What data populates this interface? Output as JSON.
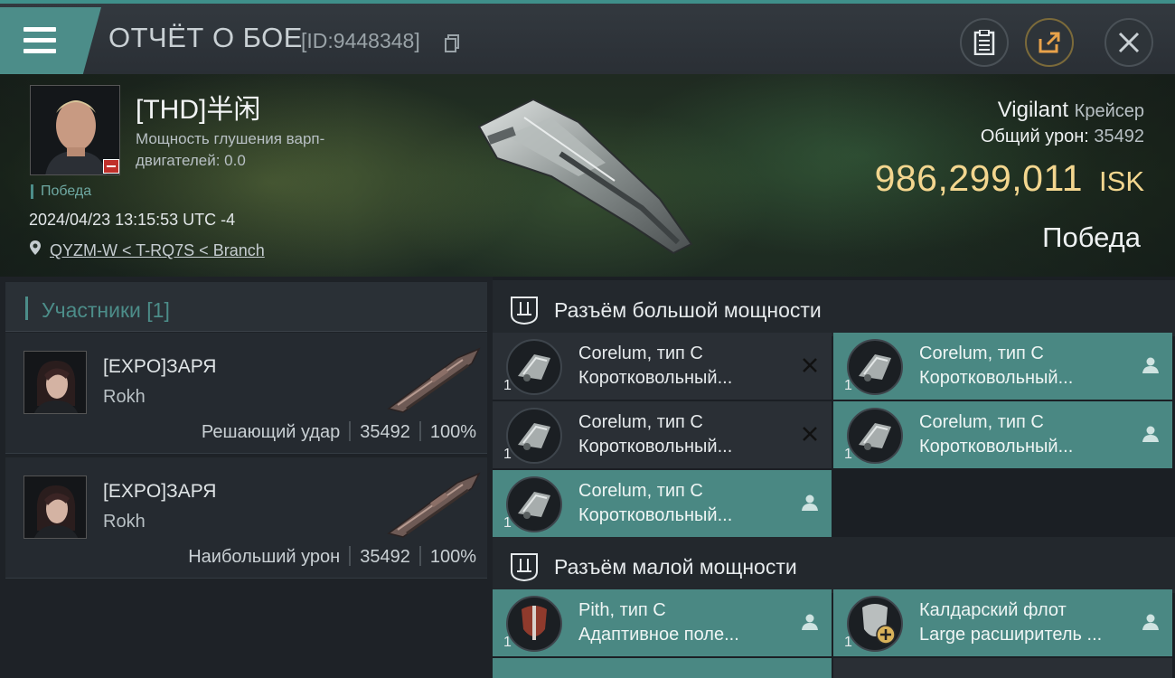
{
  "header": {
    "title": "ОТЧЁТ О БОЕ",
    "report_id": "[ID:9448348]"
  },
  "victim": {
    "name": "[THD]半闲",
    "warp_label": "Мощность глушения варп-двигателей: 0.0",
    "result_tag": "Победа",
    "datetime": "2024/04/23 13:15:53 UTC -4",
    "location": "QYZM-W < T-RQ7S < Branch",
    "ship_name": "Vigilant",
    "ship_class": "Крейсер",
    "total_damage_label": "Общий урон:",
    "total_damage": "35492",
    "isk_value": "986,299,011",
    "isk_unit": "ISK",
    "result_big": "Победа"
  },
  "participants": {
    "title": "Участники [1]",
    "items": [
      {
        "name": "[EXPO]ЗАРЯ",
        "ship": "Rokh",
        "role": "Решающий удар",
        "damage": "35492",
        "percent": "100%"
      },
      {
        "name": "[EXPO]ЗАРЯ",
        "ship": "Rokh",
        "role": "Наибольший урон",
        "damage": "35492",
        "percent": "100%"
      }
    ]
  },
  "fitting": {
    "high_title": "Разъём большой мощности",
    "low_title": "Разъём малой мощности",
    "high_slots": [
      {
        "qty": "1",
        "line1": "Corelum, тип C",
        "line2": "Коротковольный...",
        "status": "destroyed"
      },
      {
        "qty": "1",
        "line1": "Corelum, тип C",
        "line2": "Коротковольный...",
        "status": "dropped"
      },
      {
        "qty": "1",
        "line1": "Corelum, тип C",
        "line2": "Коротковольный...",
        "status": "destroyed"
      },
      {
        "qty": "1",
        "line1": "Corelum, тип C",
        "line2": "Коротковольный...",
        "status": "dropped"
      },
      {
        "qty": "1",
        "line1": "Corelum, тип C",
        "line2": "Коротковольный...",
        "status": "dropped"
      }
    ],
    "low_slots": [
      {
        "qty": "1",
        "line1": "Pith, тип C",
        "line2": "Адаптивное поле...",
        "status": "dropped"
      },
      {
        "qty": "1",
        "line1": "Калдарский флот",
        "line2": "Large расширитель ...",
        "status": "dropped"
      }
    ]
  },
  "colors": {
    "accent": "#4c8d89",
    "isk": "#f3d68f",
    "slot_dropped": "#4a8883",
    "slot_destroyed": "#2a2f35"
  },
  "icons": {
    "menu": "hamburger-icon",
    "copy": "copy-icon",
    "clipboard": "clipboard-icon",
    "share": "share-icon",
    "close": "close-icon",
    "location": "map-pin-icon",
    "slot_section": "fitting-slot-icon",
    "destroyed": "cross-icon",
    "dropped": "person-icon"
  }
}
